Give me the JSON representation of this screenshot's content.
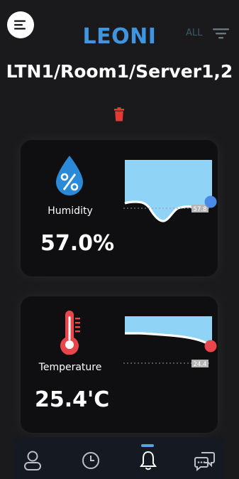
{
  "app": {
    "brand": "LEONI",
    "filter_label": "ALL",
    "path_title": "LTN1/Room1/Server1,2"
  },
  "colors": {
    "brand_blue": "#3f95df",
    "humidity_marker": "#4b8be8",
    "temperature_marker": "#e8464a",
    "chart_fill": "#8fd3f7",
    "trash_red": "#e53935"
  },
  "cards": [
    {
      "name": "humidity",
      "icon": "water-drop-percent-icon",
      "label": "Humidity",
      "value": "57.0%",
      "threshold_label": "57.8"
    },
    {
      "name": "temperature",
      "icon": "thermometer-icon",
      "label": "Temperature",
      "value": "25.4'C",
      "threshold_label": "24.4"
    }
  ],
  "nav": {
    "items": [
      {
        "name": "profile",
        "icon": "person-icon"
      },
      {
        "name": "history",
        "icon": "clock-icon"
      },
      {
        "name": "alerts",
        "icon": "bell-icon",
        "active": true
      },
      {
        "name": "chat",
        "icon": "chat-bubbles-icon"
      }
    ]
  }
}
